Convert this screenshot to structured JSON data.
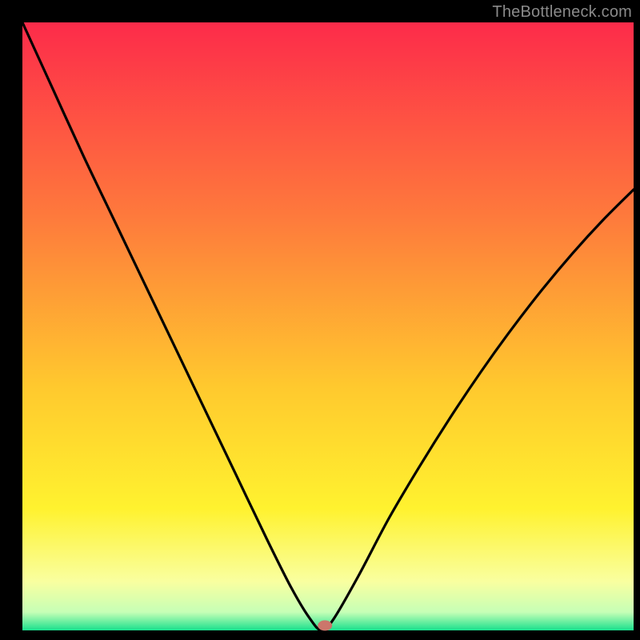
{
  "watermark": "TheBottleneck.com",
  "colors": {
    "frame": "#000000",
    "grad_top": "#fd2b4a",
    "grad_mid1": "#fe7a3c",
    "grad_mid2": "#ffc92e",
    "grad_mid3": "#fff22f",
    "grad_mid4": "#f9ffa0",
    "grad_mid5": "#c6ffb6",
    "grad_bottom": "#19e08d",
    "curve": "#000000",
    "marker": "#cc766b"
  },
  "chart_data": {
    "type": "line",
    "title": "",
    "xlabel": "",
    "ylabel": "",
    "xlim": [
      0,
      100
    ],
    "ylim": [
      0,
      100
    ],
    "x_at_min": 49,
    "marker": {
      "x": 49.5,
      "y": 0.8
    },
    "series": [
      {
        "name": "bottleneck-curve",
        "x": [
          0,
          5,
          10,
          15,
          20,
          25,
          30,
          35,
          40,
          44,
          47,
          49,
          51,
          55,
          60,
          65,
          70,
          75,
          80,
          85,
          90,
          95,
          100
        ],
        "values": [
          100,
          89,
          78,
          67.5,
          57,
          46.5,
          36,
          25.5,
          15,
          7,
          2,
          0,
          2,
          9,
          18.5,
          27,
          35,
          42.5,
          49.5,
          56,
          62,
          67.5,
          72.5
        ]
      }
    ]
  }
}
